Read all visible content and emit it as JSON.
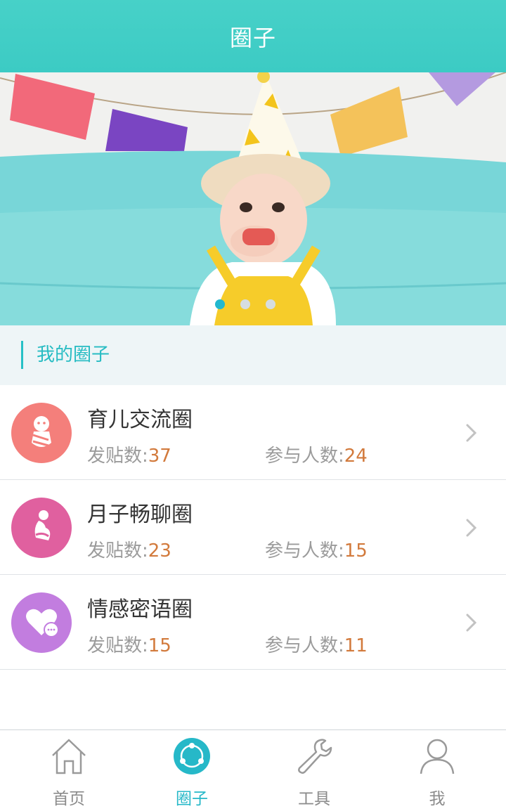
{
  "header": {
    "title": "圈子"
  },
  "banner": {
    "slide_count": 3,
    "active_slide": 1
  },
  "section": {
    "title": "我的圈子"
  },
  "circles": [
    {
      "name": "育儿交流圈",
      "posts_label": "发贴数:",
      "posts": "37",
      "members_label": "参与人数:",
      "members": "24",
      "icon": "baby-icon",
      "color": "#f47f7b"
    },
    {
      "name": "月子畅聊圈",
      "posts_label": "发贴数:",
      "posts": "23",
      "members_label": "参与人数:",
      "members": "15",
      "icon": "mother-icon",
      "color": "#e0609f"
    },
    {
      "name": "情感密语圈",
      "posts_label": "发贴数:",
      "posts": "15",
      "members_label": "参与人数:",
      "members": "11",
      "icon": "heart-chat-icon",
      "color": "#c27ddf"
    }
  ],
  "tabbar": {
    "items": [
      {
        "label": "首页",
        "icon": "home-icon",
        "active": false
      },
      {
        "label": "圈子",
        "icon": "circle-icon",
        "active": true
      },
      {
        "label": "工具",
        "icon": "wrench-icon",
        "active": false
      },
      {
        "label": "我",
        "icon": "person-icon",
        "active": false
      }
    ]
  },
  "colors": {
    "accent": "#3ccbc4",
    "stat_number": "#d27a3c",
    "active_tab": "#26b8c8"
  }
}
